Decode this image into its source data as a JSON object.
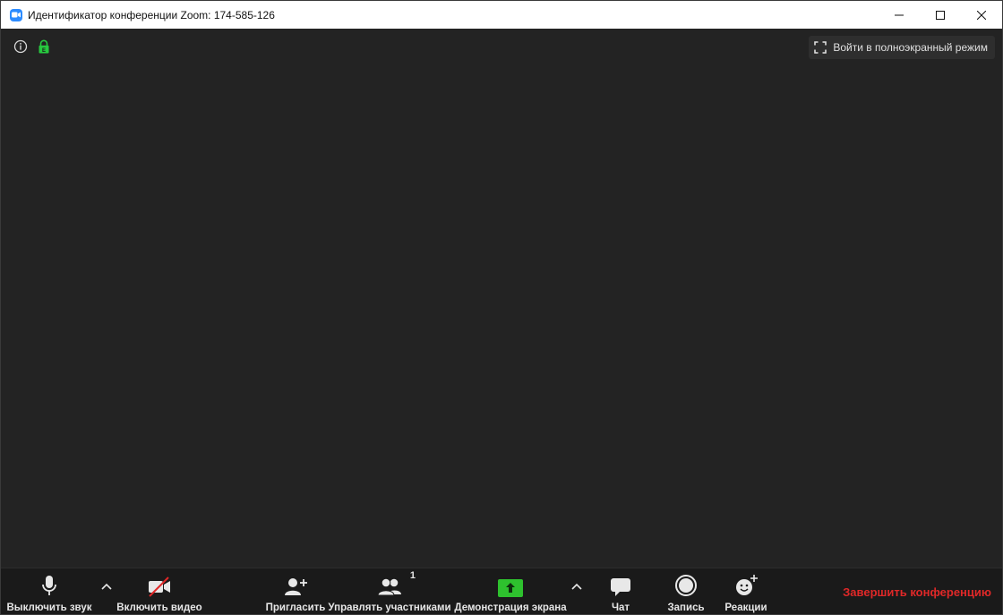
{
  "titlebar": {
    "title": "Идентификатор конференции Zoom: 174-585-126",
    "app_icon": "zoom-camera-icon",
    "controls": [
      "minimize-icon",
      "maximize-icon",
      "close-icon"
    ]
  },
  "meeting": {
    "fullscreen_label": "Войти в полноэкранный режим",
    "encryption_color": "#27c93f"
  },
  "toolbar": {
    "mute_label": "Выключить звук",
    "video_label": "Включить видео",
    "invite_label": "Пригласить",
    "participants_label": "Управлять участниками",
    "participants_count": "1",
    "share_label": "Демонстрация экрана",
    "chat_label": "Чат",
    "record_label": "Запись",
    "reactions_label": "Реакции",
    "end_label": "Завершить конференцию",
    "share_color": "#2ec12e",
    "end_color": "#e02828"
  }
}
